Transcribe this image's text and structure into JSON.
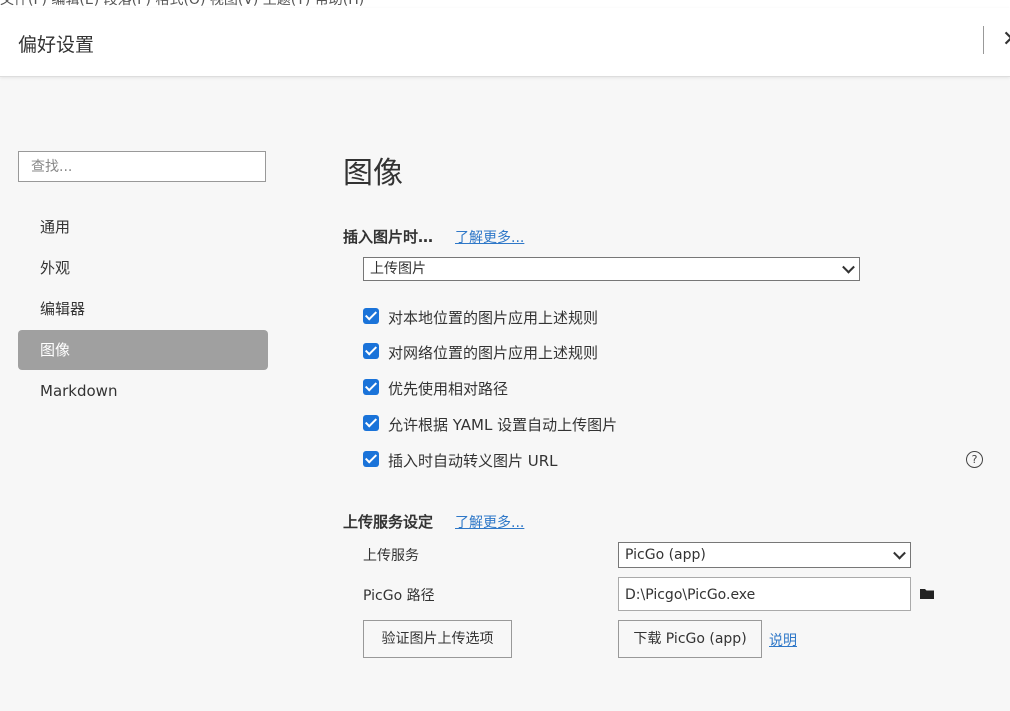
{
  "top_strip_text": "文件(F) 编辑(E) 段落(P) 格式(O) 视图(V) 主题(T) 帮助(H)",
  "header": {
    "title": "偏好设置",
    "close_glyph": "✕"
  },
  "sidebar": {
    "search_placeholder": "查找...",
    "items": [
      {
        "label": "通用"
      },
      {
        "label": "外观"
      },
      {
        "label": "编辑器"
      },
      {
        "label": "图像",
        "active": true
      },
      {
        "label": "Markdown"
      }
    ]
  },
  "main": {
    "title": "图像",
    "insert_section": {
      "label": "插入图片时…",
      "learn_more": "了解更多...",
      "select_value": "上传图片",
      "checkboxes": [
        {
          "label": "对本地位置的图片应用上述规则",
          "checked": true
        },
        {
          "label": "对网络位置的图片应用上述规则",
          "checked": true
        },
        {
          "label": "优先使用相对路径",
          "checked": true
        },
        {
          "label": "允许根据 YAML 设置自动上传图片",
          "checked": true
        },
        {
          "label": "插入时自动转义图片 URL",
          "checked": true
        }
      ],
      "help_glyph": "?"
    },
    "upload_section": {
      "label": "上传服务设定",
      "learn_more": "了解更多...",
      "service_label": "上传服务",
      "service_value": "PicGo (app)",
      "path_label": "PicGo 路径",
      "path_value": "D:\\Picgo\\PicGo.exe",
      "verify_button": "验证图片上传选项",
      "download_button": "下载 PicGo (app)",
      "explain_link": "说明"
    }
  },
  "colors": {
    "accent": "#1a73d9",
    "link": "#2f78c8",
    "active_nav": "#a0a0a0"
  },
  "icons": {
    "folder": "folder-icon",
    "help": "help-circle-icon",
    "close": "close-icon",
    "chevron": "chevron-down-icon"
  }
}
